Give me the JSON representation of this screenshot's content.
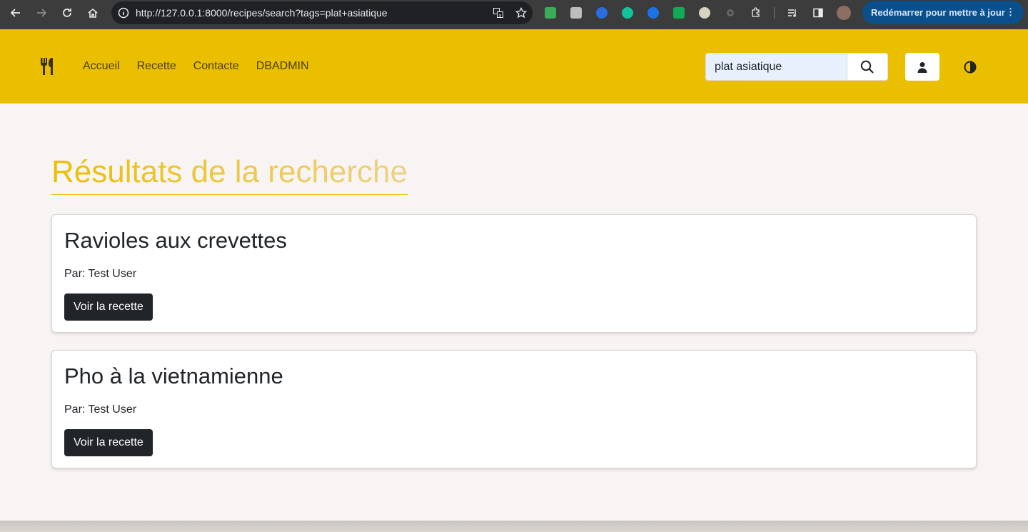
{
  "browser": {
    "url": "http://127.0.0.1:8000/recipes/search?tags=plat+asiatique",
    "update_button": "Redémarrer pour mettre à jour",
    "extensions": [
      "mail-ext",
      "reader-ext",
      "shield-ext",
      "grammarly-ext",
      "notif-ext",
      "on-ext",
      "cloud-ext",
      "gear-ext",
      "puzzle-ext"
    ]
  },
  "navbar": {
    "links": [
      "Accueil",
      "Recette",
      "Contacte",
      "DBADMIN"
    ],
    "search_value": "plat asiatique",
    "accent_color": "#eabf00"
  },
  "main": {
    "title": "Résultats de la recherche",
    "results": [
      {
        "title": "Ravioles aux crevettes",
        "author": "Par: Test User",
        "button": "Voir la recette"
      },
      {
        "title": "Pho à la vietnamienne",
        "author": "Par: Test User",
        "button": "Voir la recette"
      }
    ]
  }
}
